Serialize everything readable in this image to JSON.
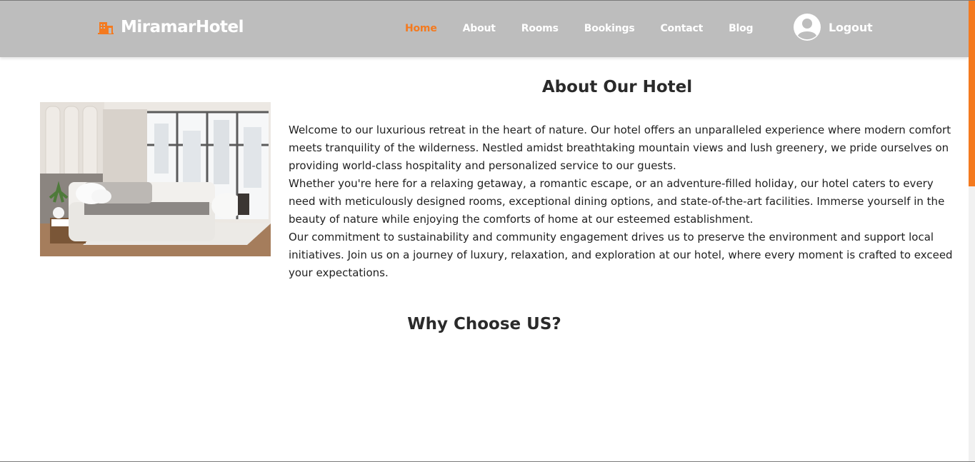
{
  "brand": {
    "name": "MiramarHotel",
    "icon": "hotel-icon",
    "accent_color": "#f47a1f"
  },
  "nav": {
    "items": [
      {
        "label": "Home",
        "active": true
      },
      {
        "label": "About",
        "active": false
      },
      {
        "label": "Rooms",
        "active": false
      },
      {
        "label": "Bookings",
        "active": false
      },
      {
        "label": "Contact",
        "active": false
      },
      {
        "label": "Blog",
        "active": false
      }
    ],
    "logout_label": "Logout",
    "avatar_icon": "user-circle-icon",
    "background_color": "#bdbdbd"
  },
  "about": {
    "title": "About Our Hotel",
    "image": "hotel-bedroom-photo",
    "paragraphs": [
      "Welcome to our luxurious retreat in the heart of nature. Our hotel offers an unparalleled experience where modern comfort meets tranquility of the wilderness. Nestled amidst breathtaking mountain views and lush greenery, we pride ourselves on providing world-class hospitality and personalized service to our guests.",
      "Whether you're here for a relaxing getaway, a romantic escape, or an adventure-filled holiday, our hotel caters to every need with meticulously designed rooms, exceptional dining options, and state-of-the-art facilities. Immerse yourself in the beauty of nature while enjoying the comforts of home at our esteemed establishment.",
      "Our commitment to sustainability and community engagement drives us to preserve the environment and support local initiatives. Join us on a journey of luxury, relaxation, and exploration at our hotel, where every moment is crafted to exceed your expectations."
    ]
  },
  "why": {
    "title": "Why Choose US?"
  }
}
